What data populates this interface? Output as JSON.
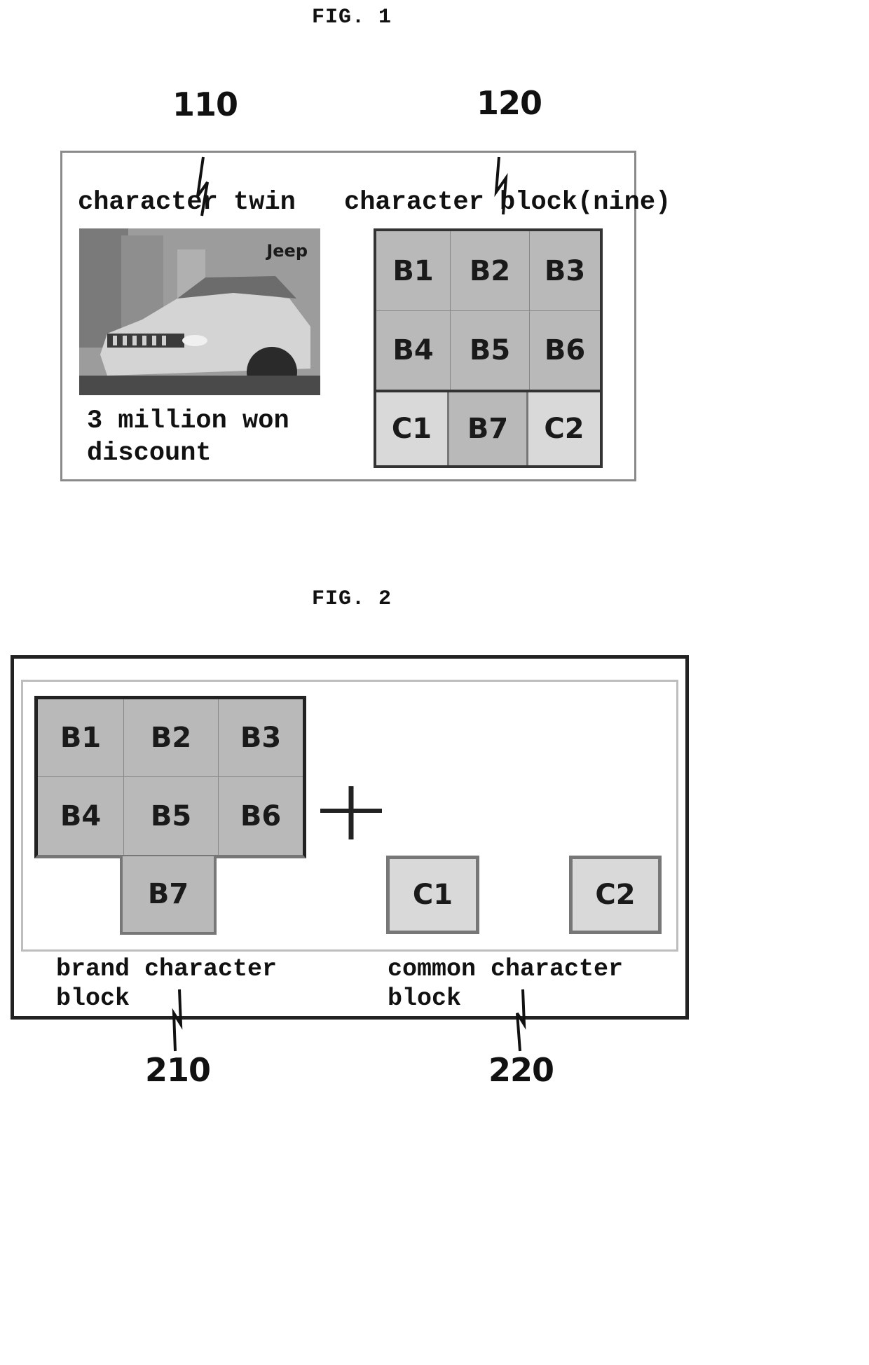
{
  "figure1": {
    "title": "FIG. 1",
    "ref_twin": "110",
    "ref_block": "120",
    "twin_label": "character twin",
    "block_label": "character block(nine)",
    "photo": {
      "brand_logo": "Jeep",
      "subject": "car-photo"
    },
    "discount_line1": "3 million won",
    "discount_line2": "discount",
    "grid_cells": [
      "B1",
      "B2",
      "B3",
      "B4",
      "B5",
      "B6",
      "C1",
      "B7",
      "C2"
    ]
  },
  "figure2": {
    "title": "FIG. 2",
    "brand_cells": [
      "B1",
      "B2",
      "B3",
      "B4",
      "B5",
      "B6",
      "B7"
    ],
    "plus_symbol": "plus-icon",
    "common_cells": [
      "C1",
      "C2"
    ],
    "brand_label_line1": "brand character",
    "brand_label_line2": "block",
    "common_label_line1": "common character",
    "common_label_line2": "block",
    "ref_brand": "210",
    "ref_common": "220"
  },
  "colors": {
    "brand_block": "#b9b9b9",
    "common_block": "#d9d9d9",
    "frame_dark": "#222222",
    "frame_light": "#8a8a8a"
  }
}
